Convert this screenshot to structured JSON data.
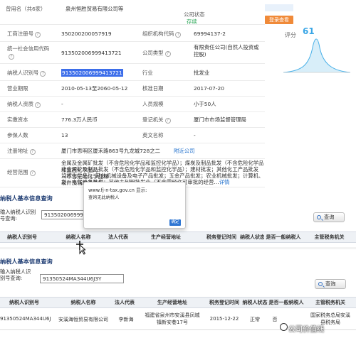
{
  "header": {
    "partial_label": "曾用名（共6家）",
    "partial_company": "泉州恒胜贸易有限公司等",
    "company_status_label": "公司状态",
    "company_status_value": "存续",
    "check_button": "登录查看"
  },
  "score": {
    "label": "评分",
    "value": "61"
  },
  "fields": [
    {
      "l1": "工商注册号",
      "v1": "350200200057919",
      "l2": "组织机构代码",
      "v2": "69994137-2"
    },
    {
      "l1": "统一社会信用代码",
      "v1": "91350200699941372​1",
      "l2": "公司类型",
      "v2": "有限责任公司(自然人投资或控股)"
    },
    {
      "l1": "纳税人识别号",
      "v1": "913502006999413721",
      "l2": "行业",
      "v2": "批发业"
    },
    {
      "l1": "营业期限",
      "v1": "2010-05-13至2060-05-12",
      "l2": "核准日期",
      "v2": "2017-07-20"
    },
    {
      "l1": "纳税人资质",
      "v1": "-",
      "l2": "人员规模",
      "v2": "小于50人"
    },
    {
      "l1": "实缴资本",
      "v1": "776.3万人民币",
      "l2": "登记机关",
      "v2": "厦门市市场监督管理局"
    },
    {
      "l1": "参保人数",
      "v1": "13",
      "l2": "英文名称",
      "v2": "-"
    }
  ],
  "address": {
    "label": "注册地址",
    "value": "厦门市思明区厦禾路863号九龙城728之二",
    "link": "附近公司"
  },
  "scope": {
    "label": "经营范围",
    "line1": "金属及金属矿批发（不含危险化学品和监控化学品）；煤炭及制品批发（不含危险化学品和监控化学品）；",
    "line2": "非金属矿及制品批发（不含危险化学品和监控化学品）；建材批发；其他化工产品批发（不含危险化学品和",
    "line3": "监控化学品）；其他机械设备及电子产品批发；五金产品批发；农业机械批发；计算机、软件及辅助设备批",
    "line4": "发；电气设备批发；其他未列明批发业（不含需经许可审批的经营…",
    "more": "详情"
  },
  "query1": {
    "title": "纳税人基本信息查询",
    "input_label": "输入纳税人识别号查询:",
    "input_value": "91350200699941372​1",
    "button": "查询"
  },
  "table_headers": [
    "纳税人识别号",
    "纳税人名称",
    "法人代表",
    "生产经营地址",
    "税务登记时间",
    "纳税人状态",
    "是否一般纳税人",
    "主管税务机关"
  ],
  "dialog": {
    "url": "www.fj-n-tax.gov.cn 显示:",
    "message": "查询无此纳税人",
    "ok": "确定"
  },
  "query2": {
    "title": "纳税人基本信息查询",
    "input_label": "输入纳税人识别号查询:",
    "input_value": "91350524MA344U6J3Y",
    "button": "查询"
  },
  "result_row": {
    "id": "91350524MA344U6J3Y",
    "name": "安溪海恒贸易有限公司",
    "legal": "李新海",
    "addr1": "福建省泉州市安溪县凤城",
    "addr2": "镇新安巷17号",
    "date": "2015-12-22",
    "status": "正常",
    "general": "否",
    "authority1": "国家税务总局安溪",
    "authority2": "县税务局"
  },
  "watermark": "公司价值线"
}
